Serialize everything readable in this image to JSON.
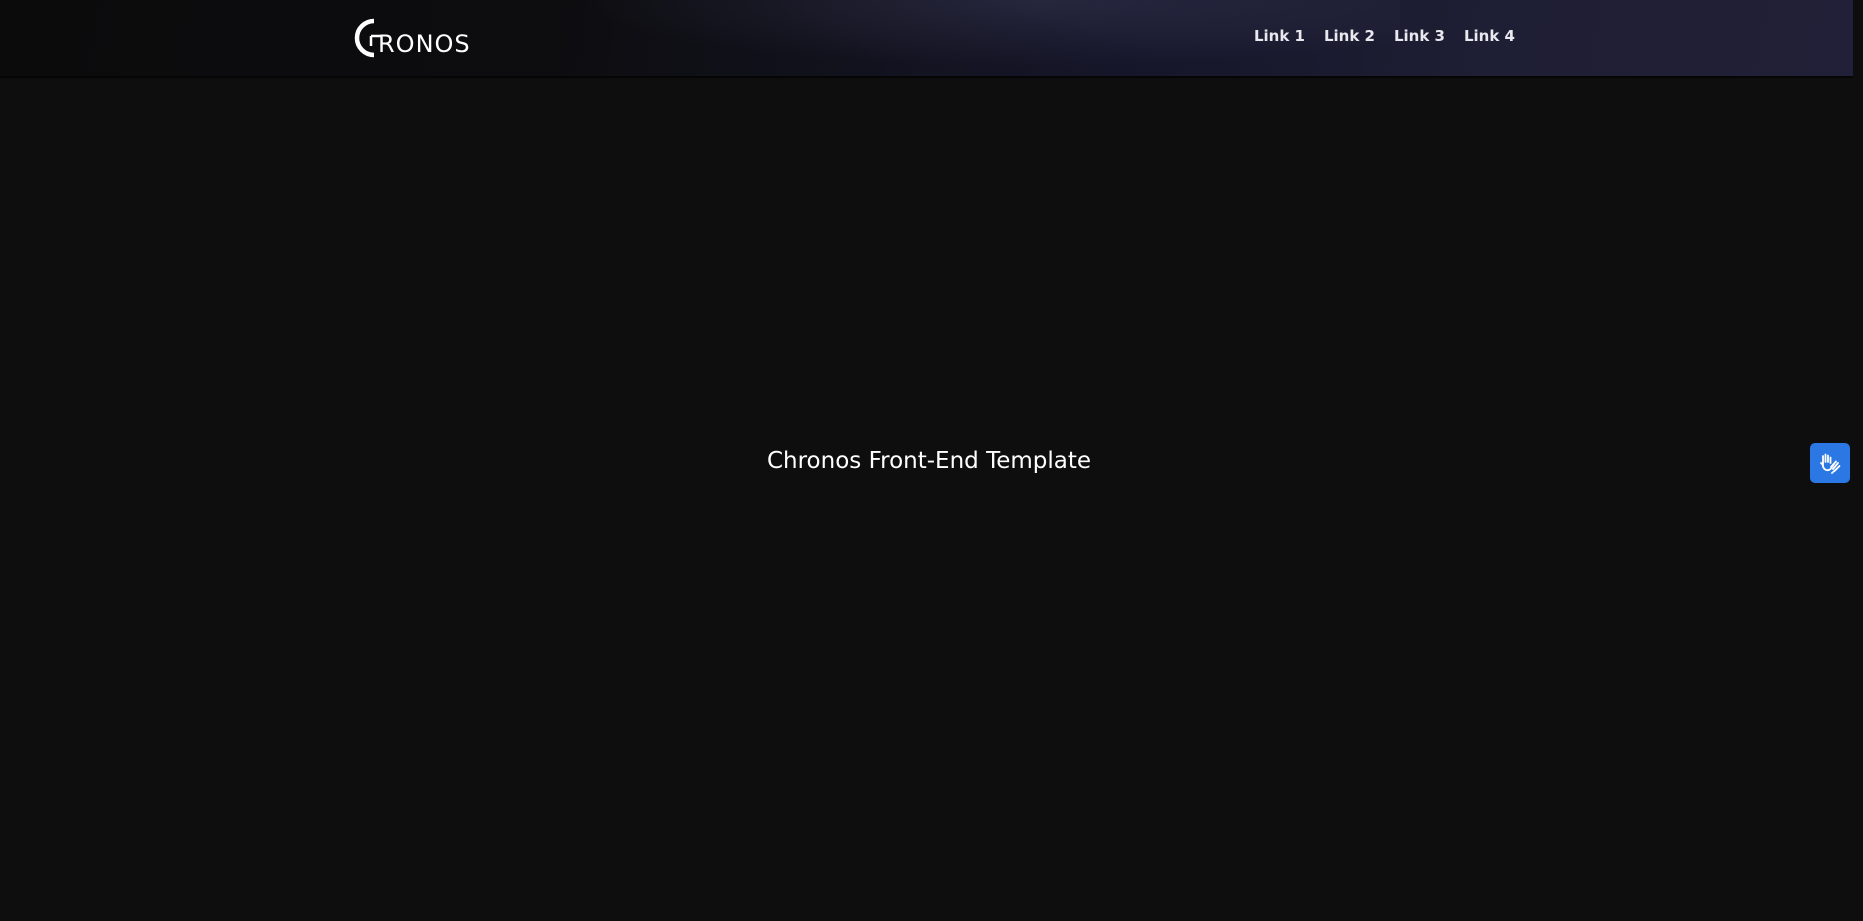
{
  "header": {
    "logo_text": "RONOS",
    "nav": [
      {
        "label": "Link 1"
      },
      {
        "label": "Link 2"
      },
      {
        "label": "Link 3"
      },
      {
        "label": "Link 4"
      }
    ]
  },
  "main": {
    "title": "Chronos Front-End Template"
  },
  "widgets": {
    "accessibility_icon": "sign-language-hands-icon",
    "accessibility_color": "#2b78e4"
  },
  "colors": {
    "background": "#0e0e0e",
    "header_gradient_end": "#222038",
    "text": "#ffffff"
  }
}
